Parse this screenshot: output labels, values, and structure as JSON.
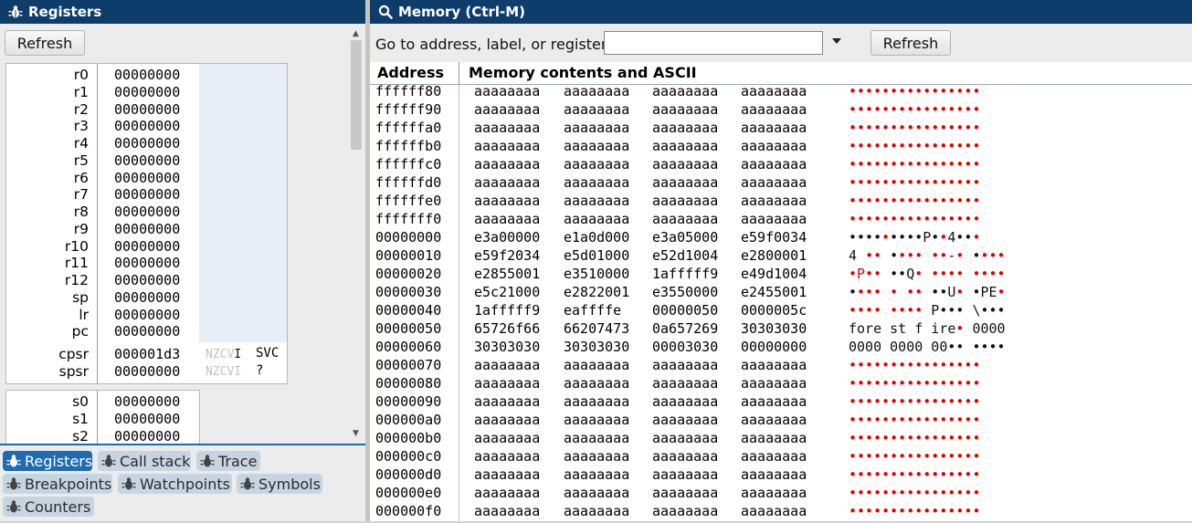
{
  "registers_panel": {
    "title": "Registers",
    "refresh_label": "Refresh",
    "core": [
      {
        "name": "r0",
        "value": "00000000"
      },
      {
        "name": "r1",
        "value": "00000000"
      },
      {
        "name": "r2",
        "value": "00000000"
      },
      {
        "name": "r3",
        "value": "00000000"
      },
      {
        "name": "r4",
        "value": "00000000"
      },
      {
        "name": "r5",
        "value": "00000000"
      },
      {
        "name": "r6",
        "value": "00000000"
      },
      {
        "name": "r7",
        "value": "00000000"
      },
      {
        "name": "r8",
        "value": "00000000"
      },
      {
        "name": "r9",
        "value": "00000000"
      },
      {
        "name": "r10",
        "value": "00000000"
      },
      {
        "name": "r11",
        "value": "00000000"
      },
      {
        "name": "r12",
        "value": "00000000"
      },
      {
        "name": "sp",
        "value": "00000000"
      },
      {
        "name": "lr",
        "value": "00000000"
      },
      {
        "name": "pc",
        "value": "00000000"
      }
    ],
    "status": [
      {
        "name": "cpsr",
        "value": "000001d3",
        "flags_dim": "NZCV",
        "flags_set": "I",
        "mode": "SVC"
      },
      {
        "name": "spsr",
        "value": "00000000",
        "flags_dim": "NZCVI",
        "flags_set": "",
        "mode": "?"
      }
    ],
    "float": [
      {
        "name": "s0",
        "value": "00000000"
      },
      {
        "name": "s1",
        "value": "00000000"
      },
      {
        "name": "s2",
        "value": "00000000"
      }
    ]
  },
  "tabs": [
    {
      "label": "Registers",
      "active": true
    },
    {
      "label": "Call stack",
      "active": false
    },
    {
      "label": "Trace",
      "active": false
    },
    {
      "label": "Breakpoints",
      "active": false
    },
    {
      "label": "Watchpoints",
      "active": false
    },
    {
      "label": "Symbols",
      "active": false
    },
    {
      "label": "Counters",
      "active": false
    }
  ],
  "memory_panel": {
    "title": "Memory (Ctrl-M)",
    "goto_label": "Go to address, label, or register:",
    "goto_value": "",
    "refresh_label": "Refresh",
    "col_address": "Address",
    "col_contents": "Memory contents and ASCII",
    "rows": [
      {
        "addr": "ffffff80",
        "words": [
          "aaaaaaaa",
          "aaaaaaaa",
          "aaaaaaaa",
          "aaaaaaaa"
        ],
        "ascii": [
          [
            "••••",
            "r"
          ],
          [
            "••••",
            "r"
          ],
          [
            "••••",
            "r"
          ],
          [
            "••••",
            "r"
          ]
        ]
      },
      {
        "addr": "ffffff90",
        "words": [
          "aaaaaaaa",
          "aaaaaaaa",
          "aaaaaaaa",
          "aaaaaaaa"
        ],
        "ascii": [
          [
            "••••",
            "r"
          ],
          [
            "••••",
            "r"
          ],
          [
            "••••",
            "r"
          ],
          [
            "••••",
            "r"
          ]
        ]
      },
      {
        "addr": "ffffffa0",
        "words": [
          "aaaaaaaa",
          "aaaaaaaa",
          "aaaaaaaa",
          "aaaaaaaa"
        ],
        "ascii": [
          [
            "••••",
            "r"
          ],
          [
            "••••",
            "r"
          ],
          [
            "••••",
            "r"
          ],
          [
            "••••",
            "r"
          ]
        ]
      },
      {
        "addr": "ffffffb0",
        "words": [
          "aaaaaaaa",
          "aaaaaaaa",
          "aaaaaaaa",
          "aaaaaaaa"
        ],
        "ascii": [
          [
            "••••",
            "r"
          ],
          [
            "••••",
            "r"
          ],
          [
            "••••",
            "r"
          ],
          [
            "••••",
            "r"
          ]
        ]
      },
      {
        "addr": "ffffffc0",
        "words": [
          "aaaaaaaa",
          "aaaaaaaa",
          "aaaaaaaa",
          "aaaaaaaa"
        ],
        "ascii": [
          [
            "••••",
            "r"
          ],
          [
            "••••",
            "r"
          ],
          [
            "••••",
            "r"
          ],
          [
            "••••",
            "r"
          ]
        ]
      },
      {
        "addr": "ffffffd0",
        "words": [
          "aaaaaaaa",
          "aaaaaaaa",
          "aaaaaaaa",
          "aaaaaaaa"
        ],
        "ascii": [
          [
            "••••",
            "r"
          ],
          [
            "••••",
            "r"
          ],
          [
            "••••",
            "r"
          ],
          [
            "••••",
            "r"
          ]
        ]
      },
      {
        "addr": "ffffffe0",
        "words": [
          "aaaaaaaa",
          "aaaaaaaa",
          "aaaaaaaa",
          "aaaaaaaa"
        ],
        "ascii": [
          [
            "••••",
            "r"
          ],
          [
            "••••",
            "r"
          ],
          [
            "••••",
            "r"
          ],
          [
            "••••",
            "r"
          ]
        ]
      },
      {
        "addr": "fffffff0",
        "words": [
          "aaaaaaaa",
          "aaaaaaaa",
          "aaaaaaaa",
          "aaaaaaaa"
        ],
        "ascii": [
          [
            "••••",
            "r"
          ],
          [
            "••••",
            "r"
          ],
          [
            "••••",
            "r"
          ],
          [
            "••••",
            "r"
          ]
        ]
      },
      {
        "addr": "00000000",
        "words": [
          "e3a00000",
          "e1a0d000",
          "e3a05000",
          "e59f0034"
        ],
        "ascii": [
          [
            "••••",
            "k"
          ],
          [
            "•",
            "r"
          ],
          [
            "•••",
            "k"
          ],
          [
            "•P•",
            "k"
          ],
          [
            "•",
            "r"
          ],
          [
            "4••",
            "k"
          ],
          [
            "•",
            "r"
          ]
        ]
      },
      {
        "addr": "00000010",
        "words": [
          "e59f2034",
          "e5d01000",
          "e52d1004",
          "e2800001"
        ],
        "ascii": [
          [
            "4 ",
            "k"
          ],
          [
            "••",
            "r"
          ],
          [
            " •",
            "k"
          ],
          [
            "•••",
            "r"
          ],
          [
            " ••",
            "r"
          ],
          [
            "-",
            "k"
          ],
          [
            "•",
            "r"
          ],
          [
            " •",
            "k"
          ],
          [
            "•••",
            "r"
          ]
        ]
      },
      {
        "addr": "00000020",
        "words": [
          "e2855001",
          "e3510000",
          "1afffff9",
          "e49d1004"
        ],
        "ascii": [
          [
            "•P••",
            "r"
          ],
          [
            " ••Q",
            "k"
          ],
          [
            "•",
            "r"
          ],
          [
            " ••••",
            "r"
          ],
          [
            " ••••",
            "r"
          ]
        ]
      },
      {
        "addr": "00000030",
        "words": [
          "e5c21000",
          "e2822001",
          "e3550000",
          "e2455001"
        ],
        "ascii": [
          [
            "•",
            "k"
          ],
          [
            "•••",
            "r"
          ],
          [
            " • ",
            "r"
          ],
          [
            "••",
            "r"
          ],
          [
            " ••U",
            "k"
          ],
          [
            "•",
            "r"
          ],
          [
            " •PE",
            "k"
          ],
          [
            "•",
            "r"
          ]
        ]
      },
      {
        "addr": "00000040",
        "words": [
          "1afffff9",
          "eaffffe",
          "00000050",
          "0000005c"
        ],
        "ascii": [
          [
            "••••",
            "r"
          ],
          [
            " ••••",
            "r"
          ],
          [
            " P•••",
            "k"
          ],
          [
            " \\•••",
            "k"
          ]
        ]
      },
      {
        "addr": "00000050",
        "words": [
          "65726f66",
          "66207473",
          "0a657269",
          "30303030"
        ],
        "ascii": [
          [
            "fore st f ire",
            "k"
          ],
          [
            "•",
            "r"
          ],
          [
            " 0000",
            "k"
          ]
        ]
      },
      {
        "addr": "00000060",
        "words": [
          "30303030",
          "30303030",
          "00003030",
          "00000000"
        ],
        "ascii": [
          [
            "0000 0000 00•• ••••",
            "k"
          ]
        ]
      },
      {
        "addr": "00000070",
        "words": [
          "aaaaaaaa",
          "aaaaaaaa",
          "aaaaaaaa",
          "aaaaaaaa"
        ],
        "ascii": [
          [
            "••••",
            "r"
          ],
          [
            "••••",
            "r"
          ],
          [
            "••••",
            "r"
          ],
          [
            "••••",
            "r"
          ]
        ]
      },
      {
        "addr": "00000080",
        "words": [
          "aaaaaaaa",
          "aaaaaaaa",
          "aaaaaaaa",
          "aaaaaaaa"
        ],
        "ascii": [
          [
            "••••",
            "r"
          ],
          [
            "••••",
            "r"
          ],
          [
            "••••",
            "r"
          ],
          [
            "••••",
            "r"
          ]
        ]
      },
      {
        "addr": "00000090",
        "words": [
          "aaaaaaaa",
          "aaaaaaaa",
          "aaaaaaaa",
          "aaaaaaaa"
        ],
        "ascii": [
          [
            "••••",
            "r"
          ],
          [
            "••••",
            "r"
          ],
          [
            "••••",
            "r"
          ],
          [
            "••••",
            "r"
          ]
        ]
      },
      {
        "addr": "000000a0",
        "words": [
          "aaaaaaaa",
          "aaaaaaaa",
          "aaaaaaaa",
          "aaaaaaaa"
        ],
        "ascii": [
          [
            "••••",
            "r"
          ],
          [
            "••••",
            "r"
          ],
          [
            "••••",
            "r"
          ],
          [
            "••••",
            "r"
          ]
        ]
      },
      {
        "addr": "000000b0",
        "words": [
          "aaaaaaaa",
          "aaaaaaaa",
          "aaaaaaaa",
          "aaaaaaaa"
        ],
        "ascii": [
          [
            "••••",
            "r"
          ],
          [
            "••••",
            "r"
          ],
          [
            "••••",
            "r"
          ],
          [
            "••••",
            "r"
          ]
        ]
      },
      {
        "addr": "000000c0",
        "words": [
          "aaaaaaaa",
          "aaaaaaaa",
          "aaaaaaaa",
          "aaaaaaaa"
        ],
        "ascii": [
          [
            "••••",
            "r"
          ],
          [
            "••••",
            "r"
          ],
          [
            "••••",
            "r"
          ],
          [
            "••••",
            "r"
          ]
        ]
      },
      {
        "addr": "000000d0",
        "words": [
          "aaaaaaaa",
          "aaaaaaaa",
          "aaaaaaaa",
          "aaaaaaaa"
        ],
        "ascii": [
          [
            "••••",
            "r"
          ],
          [
            "••••",
            "r"
          ],
          [
            "••••",
            "r"
          ],
          [
            "••••",
            "r"
          ]
        ]
      },
      {
        "addr": "000000e0",
        "words": [
          "aaaaaaaa",
          "aaaaaaaa",
          "aaaaaaaa",
          "aaaaaaaa"
        ],
        "ascii": [
          [
            "••••",
            "r"
          ],
          [
            "••••",
            "r"
          ],
          [
            "••••",
            "r"
          ],
          [
            "••••",
            "r"
          ]
        ]
      },
      {
        "addr": "000000f0",
        "words": [
          "aaaaaaaa",
          "aaaaaaaa",
          "aaaaaaaa",
          "aaaaaaaa"
        ],
        "ascii": [
          [
            "••••",
            "r"
          ],
          [
            "••••",
            "r"
          ],
          [
            "••••",
            "r"
          ],
          [
            "••••",
            "r"
          ]
        ]
      }
    ]
  },
  "colors": {
    "titlebar": "#0e3d6b",
    "accent": "#1e6ab3",
    "unmapped": "#e00000"
  },
  "icons": {
    "registers": "bug-icon",
    "memory": "search-icon"
  }
}
